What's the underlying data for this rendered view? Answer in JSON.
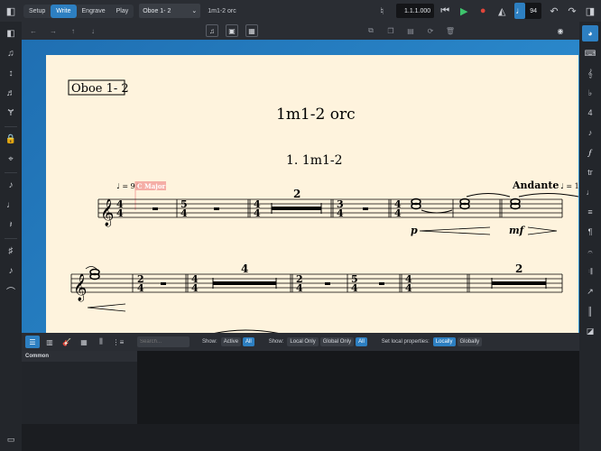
{
  "topbar": {
    "tabs": [
      {
        "label": "Setup",
        "active": false
      },
      {
        "label": "Write",
        "active": true
      },
      {
        "label": "Engrave",
        "active": false
      },
      {
        "label": "Play",
        "active": false
      }
    ],
    "layout_select": "Oboe 1- 2",
    "project_title": "1m1-2 orc",
    "timecode": "1.1.1.000",
    "tempo_value": "94"
  },
  "score": {
    "part_name": "Oboe 1- 2",
    "title": "1m1-2 orc",
    "flow_title": "1. 1m1-2",
    "tempo_mark": "♩ = 94",
    "key_signpost": "C Major",
    "tempo_text": "Andante",
    "tempo_mark_2": "♩ = 1",
    "dyn_p": "p",
    "dyn_mf": "mf",
    "mm_rest_2": "2",
    "mm_rest_4": "4",
    "mm_rest_2b": "2"
  },
  "lower_zone": {
    "search_placeholder": "Search...",
    "show_label_1": "Show:",
    "active_label": "Active",
    "all_label": "All",
    "show_label_2": "Show:",
    "local_only": "Local Only",
    "global_only": "Global Only",
    "all_label_2": "All",
    "set_local_label": "Set local properties:",
    "locally": "Locally",
    "globally": "Globally",
    "group": "Common"
  },
  "colors": {
    "accent": "#2d7fc1",
    "paper": "#fef3dd",
    "signpost": "#f4a6a0"
  }
}
